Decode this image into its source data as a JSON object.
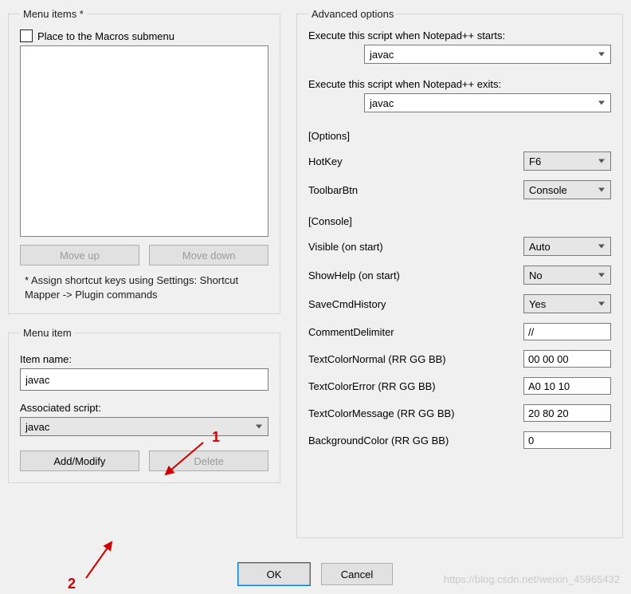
{
  "menuItems": {
    "legend": "Menu items *",
    "checkboxLabel": "Place to the Macros submenu",
    "moveUp": "Move up",
    "moveDown": "Move down",
    "hint": "* Assign shortcut keys using Settings: Shortcut Mapper -> Plugin commands"
  },
  "menuItem": {
    "legend": "Menu item",
    "itemNameLabel": "Item name:",
    "itemNameValue": "javac",
    "assocScriptLabel": "Associated script:",
    "assocScriptValue": "javac",
    "addModify": "Add/Modify",
    "delete": "Delete"
  },
  "advanced": {
    "legend": "Advanced options",
    "execStartLabel": "Execute this script when Notepad++ starts:",
    "execStartValue": "javac",
    "execExitLabel": "Execute this script when Notepad++ exits:",
    "execExitValue": "javac",
    "optionsSection": "[Options]",
    "hotkeyLabel": "HotKey",
    "hotkeyValue": "F6",
    "toolbarLabel": "ToolbarBtn",
    "toolbarValue": "Console",
    "consoleSection": "[Console]",
    "visibleLabel": "Visible (on start)",
    "visibleValue": "Auto",
    "showHelpLabel": "ShowHelp (on start)",
    "showHelpValue": "No",
    "saveCmdLabel": "SaveCmdHistory",
    "saveCmdValue": "Yes",
    "commentDelimLabel": "CommentDelimiter",
    "commentDelimValue": "//",
    "textNormalLabel": "TextColorNormal (RR GG BB)",
    "textNormalValue": "00 00 00",
    "textErrorLabel": "TextColorError (RR GG BB)",
    "textErrorValue": "A0 10 10",
    "textMsgLabel": "TextColorMessage (RR GG BB)",
    "textMsgValue": "20 80 20",
    "bgColorLabel": "BackgroundColor (RR GG BB)",
    "bgColorValue": "0"
  },
  "footer": {
    "ok": "OK",
    "cancel": "Cancel"
  },
  "annotations": {
    "one": "1",
    "two": "2"
  },
  "watermark": "https://blog.csdn.net/weixin_45965432"
}
